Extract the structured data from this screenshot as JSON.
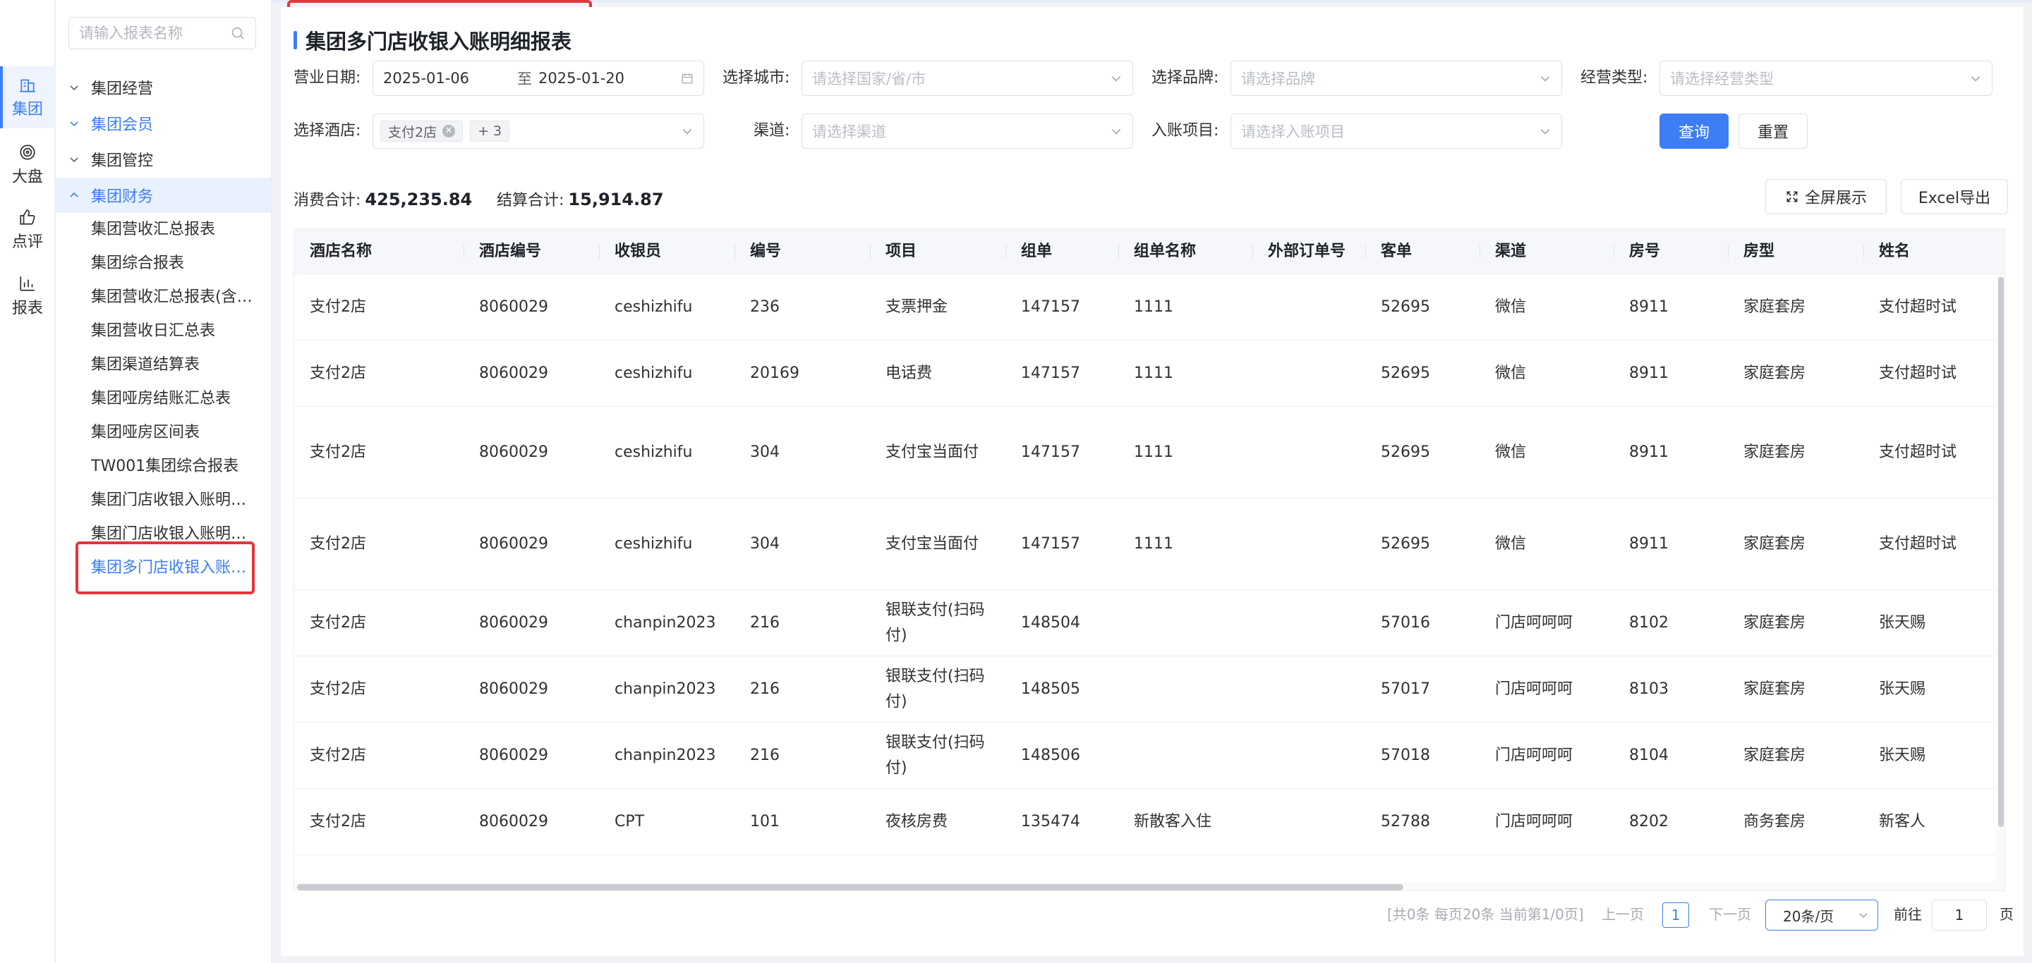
{
  "rail": [
    {
      "label": "集团",
      "icon": "building-icon",
      "active": true
    },
    {
      "label": "大盘",
      "icon": "target-icon",
      "active": false
    },
    {
      "label": "点评",
      "icon": "thumbs-up-icon",
      "active": false
    },
    {
      "label": "报表",
      "icon": "bar-chart-icon",
      "active": false
    }
  ],
  "menu": {
    "search_placeholder": "请输入报表名称",
    "groups": [
      {
        "label": "集团经营",
        "state": "collapsed"
      },
      {
        "label": "集团会员",
        "state": "collapsed-blue"
      },
      {
        "label": "集团管控",
        "state": "collapsed"
      },
      {
        "label": "集团财务",
        "state": "open"
      }
    ],
    "finance_items": [
      "集团营收汇总报表",
      "集团综合报表",
      "集团营收汇总报表(含…",
      "集团营收日汇总表",
      "集团渠道结算表",
      "集团哑房结账汇总表",
      "集团哑房区间表",
      "TW001集团综合报表",
      "集团门店收银入账明…",
      "集团门店收银入账明…",
      "集团多门店收银入账…"
    ]
  },
  "page": {
    "title": "集团多门店收银入账明细报表"
  },
  "filters": {
    "date_label": "营业日期:",
    "date_start": "2025-01-06",
    "date_sep": "至",
    "date_end": "2025-01-20",
    "city_label": "选择城市:",
    "city_placeholder": "请选择国家/省/市",
    "brand_label": "选择品牌:",
    "brand_placeholder": "请选择品牌",
    "biz_type_label": "经营类型:",
    "biz_type_placeholder": "请选择经营类型",
    "hotel_label": "选择酒店:",
    "hotel_tag": "支付2店",
    "hotel_more": "+ 3",
    "channel_label": "渠道:",
    "channel_placeholder": "请选择渠道",
    "item_label": "入账项目:",
    "item_placeholder": "请选择入账项目",
    "query_button": "查询",
    "reset_button": "重置"
  },
  "summary": {
    "consume_label": "消费合计:",
    "consume_value": "425,235.84",
    "settle_label": "结算合计:",
    "settle_value": "15,914.87",
    "fullscreen_button": "全屏展示",
    "excel_button": "Excel导出"
  },
  "table": {
    "columns": [
      "酒店名称",
      "酒店编号",
      "收银员",
      "编号",
      "项目",
      "组单",
      "组单名称",
      "外部订单号",
      "客单",
      "渠道",
      "房号",
      "房型",
      "姓名"
    ],
    "rows": [
      [
        "支付2店",
        "8060029",
        "ceshizhifu",
        "236",
        "支票押金",
        "147157",
        "1111",
        "",
        "52695",
        "微信",
        "8911",
        "家庭套房",
        "支付超时试"
      ],
      [
        "支付2店",
        "8060029",
        "ceshizhifu",
        "20169",
        "电话费",
        "147157",
        "1111",
        "",
        "52695",
        "微信",
        "8911",
        "家庭套房",
        "支付超时试"
      ],
      [
        "支付2店",
        "8060029",
        "ceshizhifu",
        "304",
        "支付宝当面付",
        "147157",
        "1111",
        "",
        "52695",
        "微信",
        "8911",
        "家庭套房",
        "支付超时试"
      ],
      [
        "支付2店",
        "8060029",
        "ceshizhifu",
        "304",
        "支付宝当面付",
        "147157",
        "1111",
        "",
        "52695",
        "微信",
        "8911",
        "家庭套房",
        "支付超时试"
      ],
      [
        "支付2店",
        "8060029",
        "chanpin2023",
        "216",
        "银联支付(扫码付)",
        "148504",
        "",
        "",
        "57016",
        "门店呵呵呵",
        "8102",
        "家庭套房",
        "张天赐"
      ],
      [
        "支付2店",
        "8060029",
        "chanpin2023",
        "216",
        "银联支付(扫码付)",
        "148505",
        "",
        "",
        "57017",
        "门店呵呵呵",
        "8103",
        "家庭套房",
        "张天赐"
      ],
      [
        "支付2店",
        "8060029",
        "chanpin2023",
        "216",
        "银联支付(扫码付)",
        "148506",
        "",
        "",
        "57018",
        "门店呵呵呵",
        "8104",
        "家庭套房",
        "张天赐"
      ],
      [
        "支付2店",
        "8060029",
        "CPT",
        "101",
        "夜核房费",
        "135474",
        "新散客入住",
        "",
        "52788",
        "门店呵呵呵",
        "8202",
        "商务套房",
        "新客人"
      ]
    ]
  },
  "pagination": {
    "info": "[共0条 每页20条 当前第1/0页]",
    "prev": "上一页",
    "page": "1",
    "next": "下一页",
    "page_size": "20条/页",
    "goto_label": "前往",
    "goto_value": "1",
    "goto_suffix": "页"
  },
  "colors": {
    "accent": "#3d7ef6",
    "highlight": "#e2353a"
  }
}
